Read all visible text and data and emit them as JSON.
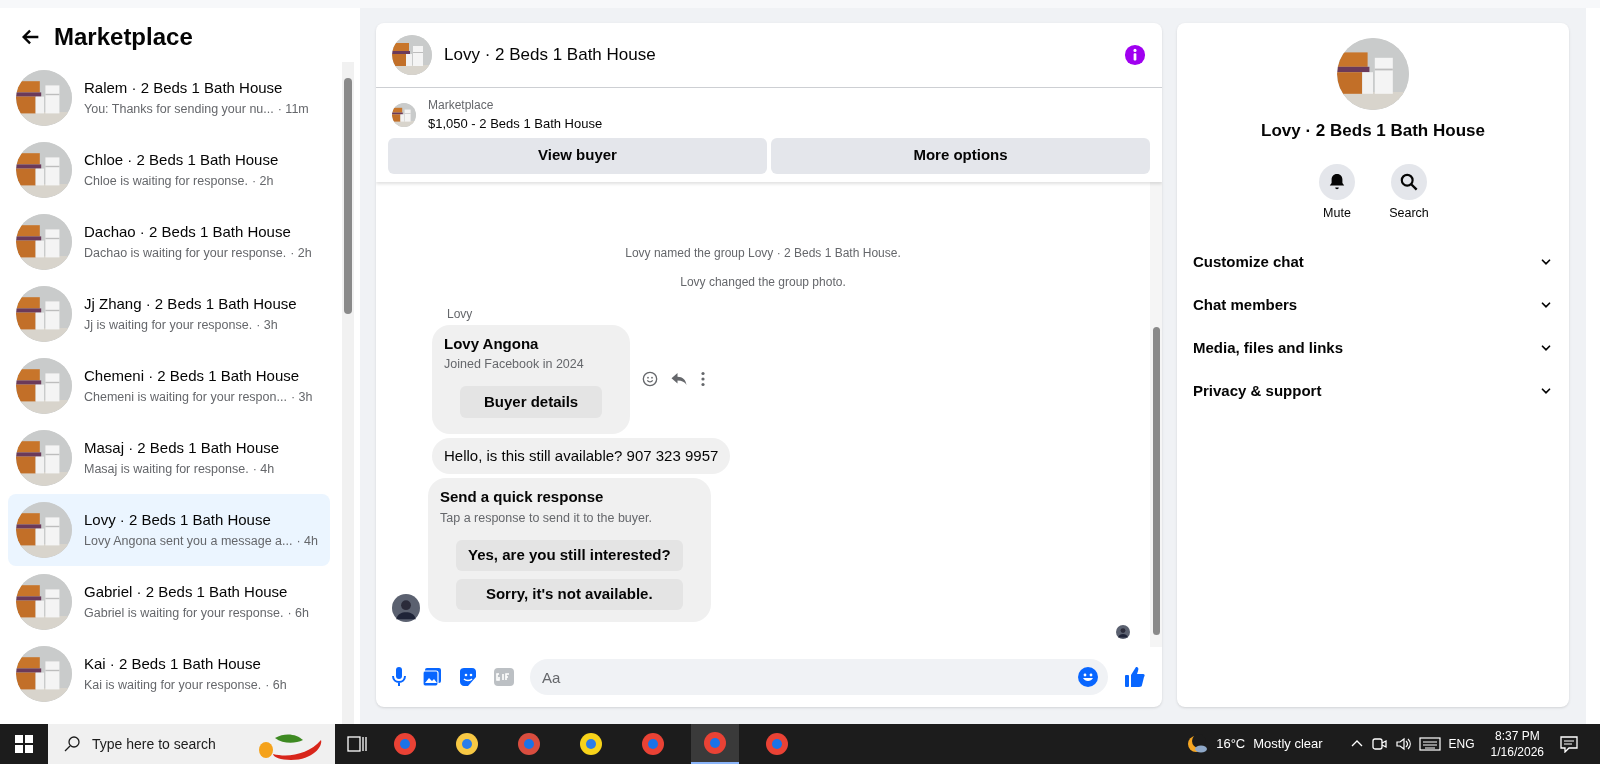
{
  "sidebar": {
    "title": "Marketplace",
    "items": [
      {
        "name": "Ralem · 2 Beds 1 Bath House",
        "preview": "You: Thanks for sending your nu...",
        "time": "· 11m",
        "selected": false
      },
      {
        "name": "Chloe · 2 Beds 1 Bath House",
        "preview": "Chloe is waiting for response.",
        "time": "· 2h",
        "selected": false
      },
      {
        "name": "Dachao · 2 Beds 1 Bath House",
        "preview": "Dachao is waiting for your response.",
        "time": "· 2h",
        "selected": false
      },
      {
        "name": "Jj Zhang · 2 Beds 1 Bath House",
        "preview": "Jj is waiting for your response.",
        "time": "· 3h",
        "selected": false
      },
      {
        "name": "Chemeni · 2 Beds 1 Bath House",
        "preview": "Chemeni is waiting for your respon...",
        "time": "· 3h",
        "selected": false
      },
      {
        "name": "Masaj · 2 Beds 1 Bath House",
        "preview": "Masaj is waiting for response.",
        "time": "· 4h",
        "selected": false
      },
      {
        "name": "Lovy · 2 Beds 1 Bath House",
        "preview": "Lovy Angona sent you a message a...",
        "time": "· 4h",
        "selected": true
      },
      {
        "name": "Gabriel · 2 Beds 1 Bath House",
        "preview": "Gabriel is waiting for your response.",
        "time": "· 6h",
        "selected": false
      },
      {
        "name": "Kai · 2 Beds 1 Bath House",
        "preview": "Kai is waiting for your response.",
        "time": "· 6h",
        "selected": false
      }
    ]
  },
  "chat": {
    "title": "Lovy · 2 Beds 1 Bath House",
    "listing": {
      "label": "Marketplace",
      "title": "$1,050 - 2 Beds 1 Bath House"
    },
    "buttons": [
      "View buyer",
      "More options"
    ],
    "events": [
      "Lovy named the group Lovy · 2 Beds 1 Bath House.",
      "Lovy changed the group photo."
    ],
    "sender": "Lovy",
    "card": {
      "name": "Lovy Angona",
      "subtitle": "Joined Facebook in 2024",
      "button": "Buyer details"
    },
    "message": "Hello, is this still available? 907 323 9957",
    "quick": {
      "title": "Send a quick response",
      "subtitle": "Tap a response to send it to the buyer.",
      "options": [
        "Yes, are you still interested?",
        "Sorry, it's not available."
      ]
    },
    "composer": {
      "placeholder": "Aa"
    }
  },
  "details": {
    "title": "Lovy · 2 Beds 1 Bath House",
    "actions": [
      {
        "label": "Mute",
        "kind": "bell"
      },
      {
        "label": "Search",
        "kind": "search"
      }
    ],
    "sections": [
      {
        "label": "Customize chat",
        "expanded": false
      },
      {
        "label": "Chat members",
        "expanded": false
      },
      {
        "label": "Media, files and links",
        "expanded": false
      },
      {
        "label": "Privacy & support",
        "expanded": false
      }
    ]
  },
  "taskbar": {
    "search_placeholder": "Type here to search",
    "temperature": "16°C",
    "weather": "Mostly clear",
    "language": "ENG",
    "time": "8:37 PM",
    "date": "1/16/2026"
  }
}
